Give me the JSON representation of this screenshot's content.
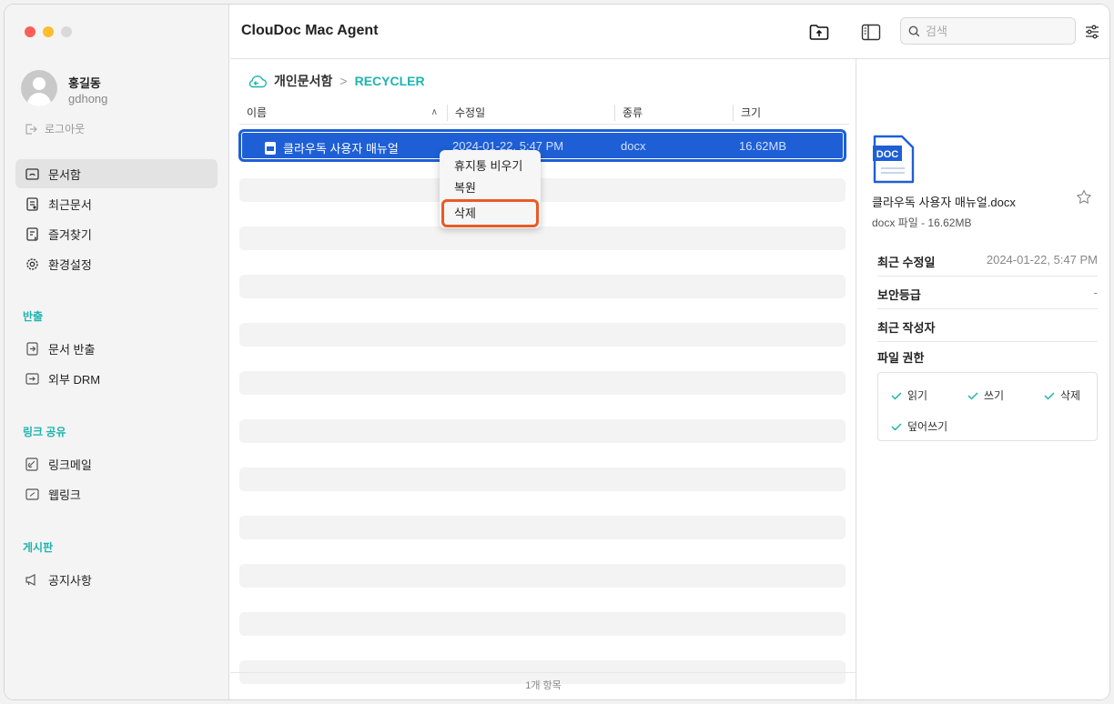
{
  "app": {
    "title": "ClouDoc Mac Agent"
  },
  "user": {
    "name": "홍길동",
    "id": "gdhong",
    "logout": "로그아웃"
  },
  "sidebar": {
    "main_items": [
      {
        "label": "문서함",
        "icon": "folder-icon",
        "active": true
      },
      {
        "label": "최근문서",
        "icon": "recent-doc-icon"
      },
      {
        "label": "즐겨찾기",
        "icon": "favorite-doc-icon"
      },
      {
        "label": "환경설정",
        "icon": "gear-icon"
      }
    ],
    "export_section": {
      "title": "반출",
      "items": [
        {
          "label": "문서 반출",
          "icon": "export-doc-icon"
        },
        {
          "label": "외부 DRM",
          "icon": "external-drm-icon"
        }
      ]
    },
    "link_section": {
      "title": "링크 공유",
      "items": [
        {
          "label": "링크메일",
          "icon": "link-mail-icon"
        },
        {
          "label": "웹링크",
          "icon": "web-link-icon"
        }
      ]
    },
    "board_section": {
      "title": "게시판",
      "items": [
        {
          "label": "공지사항",
          "icon": "megaphone-icon"
        }
      ]
    }
  },
  "toolbar": {
    "search_placeholder": "검색"
  },
  "breadcrumb": {
    "root": "개인문서함",
    "separator": ">",
    "current": "RECYCLER"
  },
  "list": {
    "columns": [
      "이름",
      "수정일",
      "종류",
      "크기"
    ],
    "rows": [
      {
        "name": "클라우독 사용자 매뉴얼",
        "modified": "2024-01-22, 5:47 PM",
        "type": "docx",
        "size": "16.62MB"
      }
    ],
    "footer": "1개 항목"
  },
  "context_menu": {
    "items": [
      "휴지통 비우기",
      "복원",
      "삭제"
    ]
  },
  "detail": {
    "doc_badge": "DOC",
    "file_name": "클라우독 사용자 매뉴얼.docx",
    "file_meta": "docx 파일 - 16.62MB",
    "info": [
      {
        "label": "최근 수정일",
        "value": "2024-01-22, 5:47 PM"
      },
      {
        "label": "보안등급",
        "value": "-"
      },
      {
        "label": "최근 작성자",
        "value": ""
      }
    ],
    "permissions_title": "파일 권한",
    "permissions": [
      "읽기",
      "쓰기",
      "삭제",
      "덮어쓰기"
    ]
  },
  "colors": {
    "accent": "#1cb5b0",
    "selection": "#1e5fd6",
    "highlight": "#ea5a26"
  }
}
